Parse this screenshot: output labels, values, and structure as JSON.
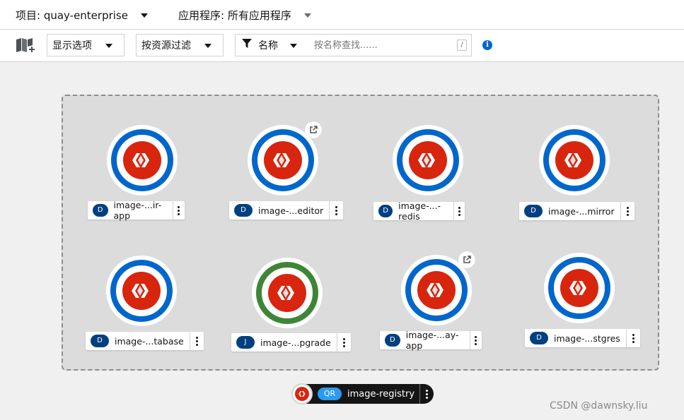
{
  "topbar": {
    "project_label": "项目: quay-enterprise",
    "application_label": "应用程序: 所有应用程序"
  },
  "toolbar": {
    "display_options": "显示选项",
    "filter_by_resource": "按资源过滤",
    "filter_type": "名称",
    "search_placeholder": "按名称查找......",
    "shortcut_key": "/"
  },
  "nodes": [
    {
      "badge": "D",
      "name": "image-...ir-app",
      "kind": "deployment",
      "has_link": false
    },
    {
      "badge": "D",
      "name": "image-...editor",
      "kind": "deployment",
      "has_link": true
    },
    {
      "badge": "D",
      "name": "image-...-redis",
      "kind": "deployment",
      "has_link": false
    },
    {
      "badge": "D",
      "name": "image-...mirror",
      "kind": "deployment",
      "has_link": false
    },
    {
      "badge": "D",
      "name": "image-...tabase",
      "kind": "deployment",
      "has_link": false
    },
    {
      "badge": "J",
      "name": "image-...pgrade",
      "kind": "job",
      "has_link": false
    },
    {
      "badge": "D",
      "name": "image-...ay-app",
      "kind": "deployment",
      "has_link": true
    },
    {
      "badge": "D",
      "name": "image-...stgres",
      "kind": "deployment",
      "has_link": false
    }
  ],
  "application_group": {
    "badge": "QR",
    "name": "image-registry"
  },
  "watermark": "CSDN @dawnsky.liu",
  "colors": {
    "deployment_ring": "#0066cc",
    "job_ring": "#3e8635",
    "logo": "#d8250e",
    "badge": "#004080"
  }
}
